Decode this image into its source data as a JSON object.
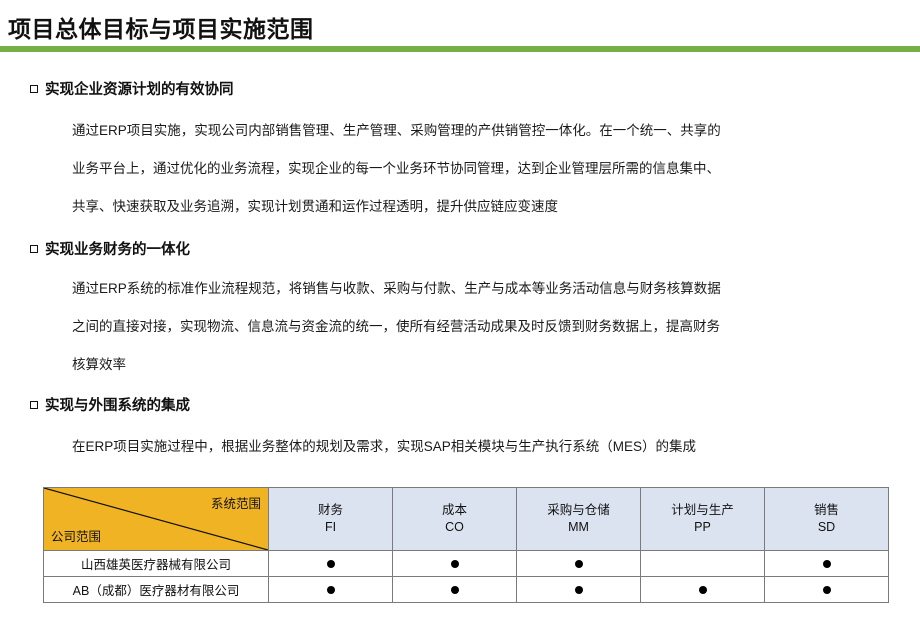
{
  "slide": {
    "title": "项目总体目标与项目实施范围",
    "accent_color": "#76B043"
  },
  "sections": [
    {
      "heading": "实现企业资源计划的有效协同",
      "lines": [
        "通过ERP项目实施，实现公司内部销售管理、生产管理、采购管理的产供销管控一体化。在一个统一、共享的",
        "业务平台上，通过优化的业务流程，实现企业的每一个业务环节协同管理，达到企业管理层所需的信息集中、",
        "共享、快速获取及业务追溯，实现计划贯通和运作过程透明，提升供应链应变速度"
      ]
    },
    {
      "heading": "实现业务财务的一体化",
      "lines": [
        "通过ERP系统的标准作业流程规范，将销售与收款、采购与付款、生产与成本等业务活动信息与财务核算数据",
        "之间的直接对接，实现物流、信息流与资金流的统一，使所有经营活动成果及时反馈到财务数据上，提高财务",
        "核算效率"
      ]
    },
    {
      "heading": "实现与外围系统的集成",
      "lines": [
        "在ERP项目实施过程中，根据业务整体的规划及需求，实现SAP相关模块与生产执行系统（MES）的集成"
      ]
    }
  ],
  "table": {
    "corner": {
      "top_label": "系统范围",
      "bottom_label": "公司范围",
      "fill_color": "#F0B323"
    },
    "header_fill_color": "#DCE3F0",
    "columns": [
      {
        "name": "财务",
        "code": "FI"
      },
      {
        "name": "成本",
        "code": "CO"
      },
      {
        "name": "采购与仓储",
        "code": "MM"
      },
      {
        "name": "计划与生产",
        "code": "PP"
      },
      {
        "name": "销售",
        "code": "SD"
      }
    ],
    "rows": [
      {
        "label": "山西雄英医疗器械有限公司",
        "marks": [
          "●",
          "●",
          "●",
          "",
          "●"
        ]
      },
      {
        "label": "AB（成都）医疗器材有限公司",
        "marks": [
          "●",
          "●",
          "●",
          "●",
          "●"
        ]
      }
    ]
  }
}
